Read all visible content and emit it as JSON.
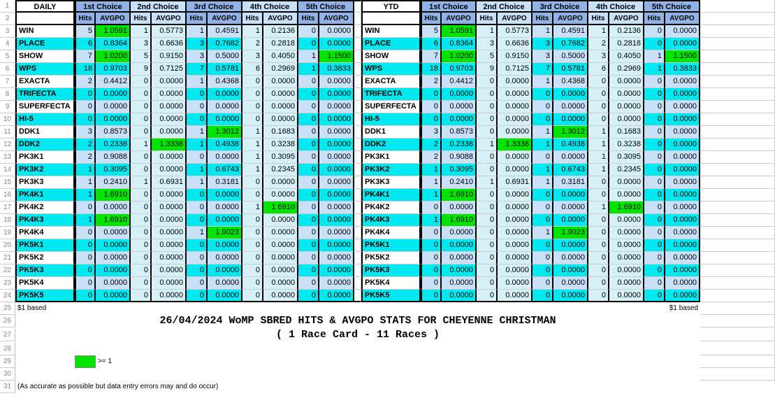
{
  "headers": {
    "daily": "DAILY",
    "ytd": "YTD",
    "choices": [
      "1st Choice",
      "2nd Choice",
      "3rd Choice",
      "4th Choice",
      "5th Choice"
    ],
    "hits": "Hits",
    "avgpo": "AVGPO"
  },
  "row_labels": [
    "WIN",
    "PLACE",
    "SHOW",
    "WPS",
    "EXACTA",
    "TRIFECTA",
    "SUPERFECTA",
    "HI-5",
    "DDK1",
    "DDK2",
    "PK3K1",
    "PK3K2",
    "PK3K3",
    "PK4K1",
    "PK4K2",
    "PK4K3",
    "PK4K4",
    "PK5K1",
    "PK5K2",
    "PK5K3",
    "PK5K4",
    "PK5K5"
  ],
  "chart_data": {
    "type": "table",
    "sections": [
      "DAILY",
      "YTD"
    ],
    "choices": [
      "1st Choice",
      "2nd Choice",
      "3rd Choice",
      "4th Choice",
      "5th Choice"
    ],
    "rows": [
      {
        "label": "WIN",
        "values": [
          [
            5,
            1.0591
          ],
          [
            1,
            0.5773
          ],
          [
            1,
            0.4591
          ],
          [
            1,
            0.2136
          ],
          [
            0,
            0.0
          ]
        ]
      },
      {
        "label": "PLACE",
        "values": [
          [
            6,
            0.8364
          ],
          [
            3,
            0.6636
          ],
          [
            3,
            0.7682
          ],
          [
            2,
            0.2818
          ],
          [
            0,
            0.0
          ]
        ]
      },
      {
        "label": "SHOW",
        "values": [
          [
            7,
            1.02
          ],
          [
            5,
            0.915
          ],
          [
            3,
            0.5
          ],
          [
            3,
            0.405
          ],
          [
            1,
            1.15
          ]
        ]
      },
      {
        "label": "WPS",
        "values": [
          [
            18,
            0.9703
          ],
          [
            9,
            0.7125
          ],
          [
            7,
            0.5781
          ],
          [
            6,
            0.2969
          ],
          [
            1,
            0.3833
          ]
        ]
      },
      {
        "label": "EXACTA",
        "values": [
          [
            2,
            0.4412
          ],
          [
            0,
            0.0
          ],
          [
            1,
            0.4368
          ],
          [
            0,
            0.0
          ],
          [
            0,
            0.0
          ]
        ]
      },
      {
        "label": "TRIFECTA",
        "values": [
          [
            0,
            0.0
          ],
          [
            0,
            0.0
          ],
          [
            0,
            0.0
          ],
          [
            0,
            0.0
          ],
          [
            0,
            0.0
          ]
        ]
      },
      {
        "label": "SUPERFECTA",
        "values": [
          [
            0,
            0.0
          ],
          [
            0,
            0.0
          ],
          [
            0,
            0.0
          ],
          [
            0,
            0.0
          ],
          [
            0,
            0.0
          ]
        ]
      },
      {
        "label": "HI-5",
        "values": [
          [
            0,
            0.0
          ],
          [
            0,
            0.0
          ],
          [
            0,
            0.0
          ],
          [
            0,
            0.0
          ],
          [
            0,
            0.0
          ]
        ]
      },
      {
        "label": "DDK1",
        "values": [
          [
            3,
            0.8573
          ],
          [
            0,
            0.0
          ],
          [
            1,
            1.3012
          ],
          [
            1,
            0.1683
          ],
          [
            0,
            0.0
          ]
        ]
      },
      {
        "label": "DDK2",
        "values": [
          [
            2,
            0.2338
          ],
          [
            1,
            1.3338
          ],
          [
            1,
            0.4938
          ],
          [
            1,
            0.3238
          ],
          [
            0,
            0.0
          ]
        ]
      },
      {
        "label": "PK3K1",
        "values": [
          [
            2,
            0.9088
          ],
          [
            0,
            0.0
          ],
          [
            0,
            0.0
          ],
          [
            1,
            0.3095
          ],
          [
            0,
            0.0
          ]
        ]
      },
      {
        "label": "PK3K2",
        "values": [
          [
            1,
            0.3095
          ],
          [
            0,
            0.0
          ],
          [
            1,
            0.6743
          ],
          [
            1,
            0.2345
          ],
          [
            0,
            0.0
          ]
        ]
      },
      {
        "label": "PK3K3",
        "values": [
          [
            1,
            0.241
          ],
          [
            1,
            0.6931
          ],
          [
            1,
            0.3181
          ],
          [
            0,
            0.0
          ],
          [
            0,
            0.0
          ]
        ]
      },
      {
        "label": "PK4K1",
        "values": [
          [
            1,
            1.691
          ],
          [
            0,
            0.0
          ],
          [
            0,
            0.0
          ],
          [
            0,
            0.0
          ],
          [
            0,
            0.0
          ]
        ]
      },
      {
        "label": "PK4K2",
        "values": [
          [
            0,
            0.0
          ],
          [
            0,
            0.0
          ],
          [
            0,
            0.0
          ],
          [
            1,
            1.691
          ],
          [
            0,
            0.0
          ]
        ]
      },
      {
        "label": "PK4K3",
        "values": [
          [
            1,
            1.691
          ],
          [
            0,
            0.0
          ],
          [
            0,
            0.0
          ],
          [
            0,
            0.0
          ],
          [
            0,
            0.0
          ]
        ]
      },
      {
        "label": "PK4K4",
        "values": [
          [
            0,
            0.0
          ],
          [
            0,
            0.0
          ],
          [
            1,
            1.9023
          ],
          [
            0,
            0.0
          ],
          [
            0,
            0.0
          ]
        ]
      },
      {
        "label": "PK5K1",
        "values": [
          [
            0,
            0.0
          ],
          [
            0,
            0.0
          ],
          [
            0,
            0.0
          ],
          [
            0,
            0.0
          ],
          [
            0,
            0.0
          ]
        ]
      },
      {
        "label": "PK5K2",
        "values": [
          [
            0,
            0.0
          ],
          [
            0,
            0.0
          ],
          [
            0,
            0.0
          ],
          [
            0,
            0.0
          ],
          [
            0,
            0.0
          ]
        ]
      },
      {
        "label": "PK5K3",
        "values": [
          [
            0,
            0.0
          ],
          [
            0,
            0.0
          ],
          [
            0,
            0.0
          ],
          [
            0,
            0.0
          ],
          [
            0,
            0.0
          ]
        ]
      },
      {
        "label": "PK5K4",
        "values": [
          [
            0,
            0.0
          ],
          [
            0,
            0.0
          ],
          [
            0,
            0.0
          ],
          [
            0,
            0.0
          ],
          [
            0,
            0.0
          ]
        ]
      },
      {
        "label": "PK5K5",
        "values": [
          [
            0,
            0.0
          ],
          [
            0,
            0.0
          ],
          [
            0,
            0.0
          ],
          [
            0,
            0.0
          ],
          [
            0,
            0.0
          ]
        ]
      }
    ]
  },
  "notes": {
    "dollar": "$1 based",
    "title": "26/04/2024 WoMP SBRED HITS & AVGPO STATS FOR CHEYENNE CHRISTMAN",
    "subtitle": "( 1 Race Card - 11 Races )",
    "legend": ">= 1",
    "disclaimer": "(As accurate as possible but data entry errors may and do occur)"
  },
  "colors": {
    "header_dark": "#8fb3e6",
    "header_light": "#c8e0f8",
    "pale": "#d5f0f7",
    "cyan": "#00e8f0",
    "green": "#00e400"
  }
}
